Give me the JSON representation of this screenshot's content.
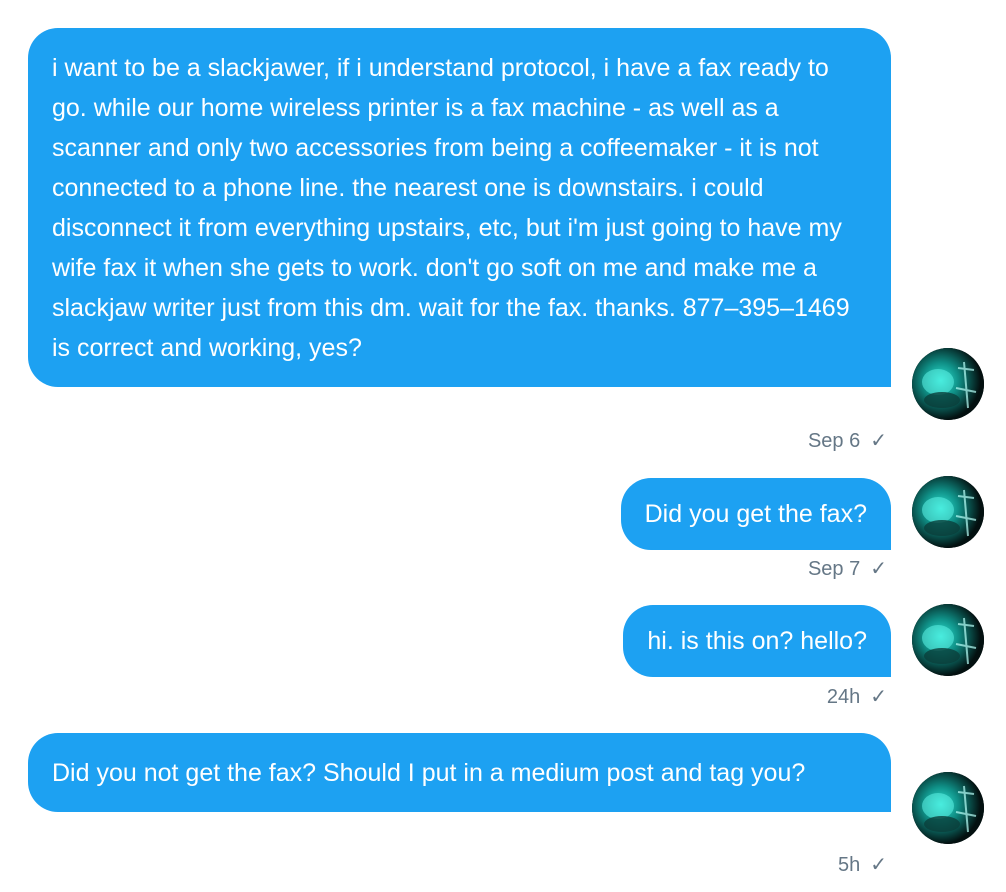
{
  "conversation": {
    "messages": [
      {
        "text": "i want to be a slackjawer, if i understand protocol, i have a fax ready to go. while our home wireless printer is a fax machine - as well as a scanner and only two accessories from being a coffeemaker - it is not connected to a phone line. the nearest one is downstairs. i could disconnect it from everything upstairs, etc, but i'm just going to have my wife fax it when she gets to work. don't go soft on me and make me a slackjaw writer just from this dm. wait for the fax. thanks. 877–395–1469 is correct and working, yes?",
        "time": "Sep 6",
        "status_icon": "✓"
      },
      {
        "text": "Did you get the fax?",
        "time": "Sep 7",
        "status_icon": "✓"
      },
      {
        "text": "hi. is this on? hello?",
        "time": "24h",
        "status_icon": "✓"
      },
      {
        "text": "Did you not get the fax? Should I put in a medium post and tag you?",
        "time": "5h",
        "status_icon": "✓"
      }
    ],
    "avatar_icon": "user-avatar-teal-xray",
    "colors": {
      "bubble": "#1da1f2",
      "bubble_text": "#ffffff",
      "meta_text": "#657786",
      "avatar_glow": "#19d3c5"
    }
  }
}
